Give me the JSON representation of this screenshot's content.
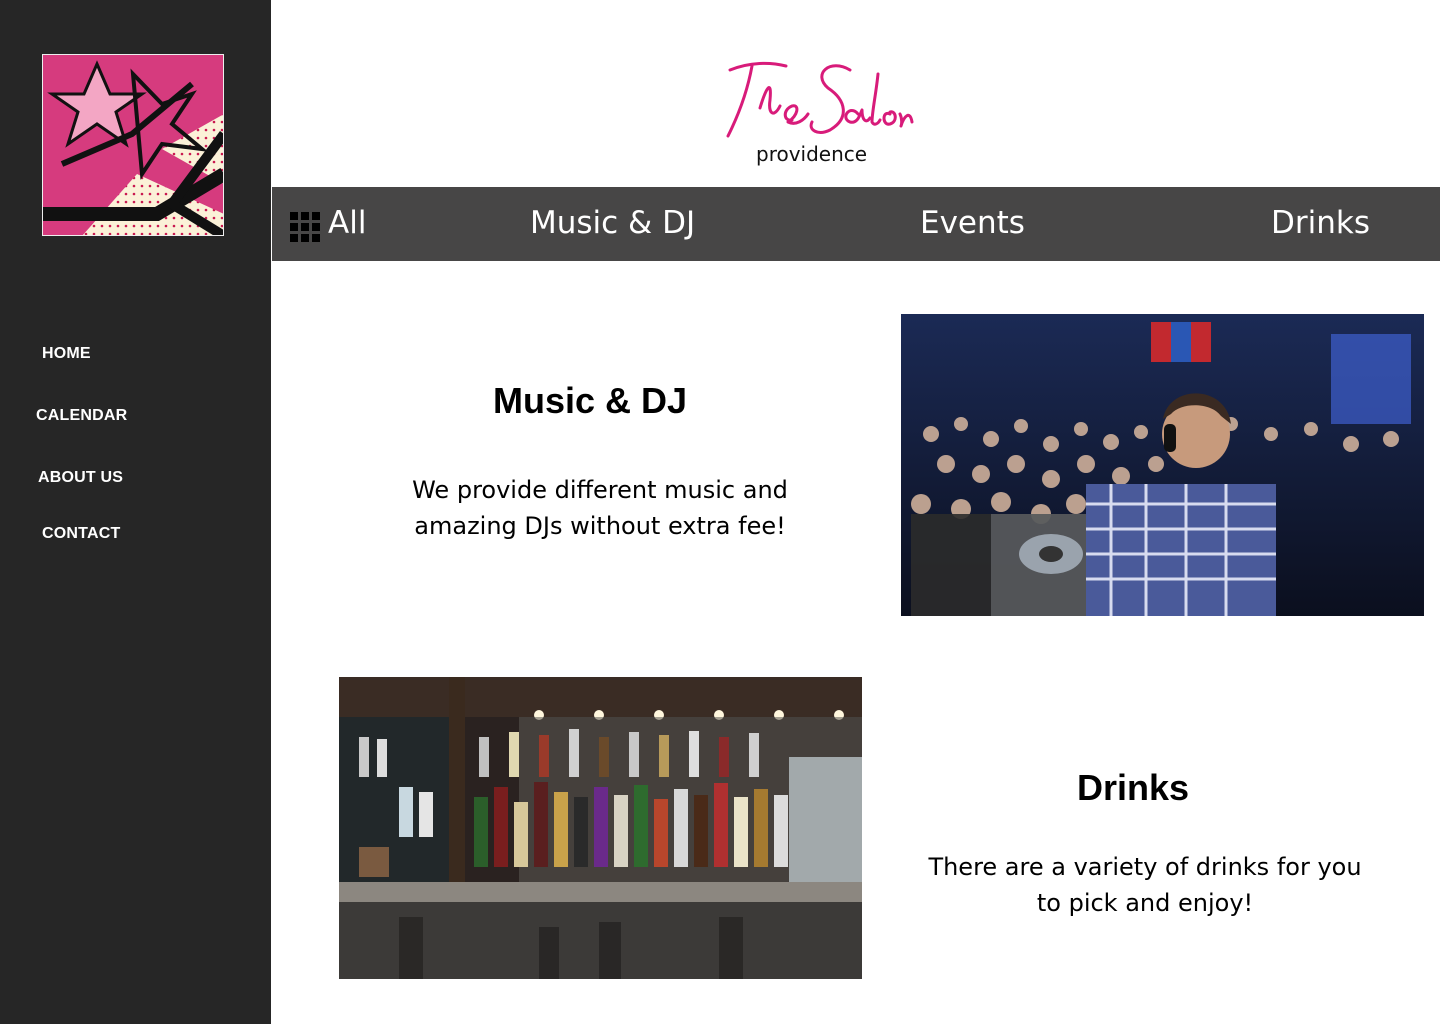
{
  "sidebar": {
    "nav": [
      {
        "label": "HOME"
      },
      {
        "label": "CALENDAR"
      },
      {
        "label": "ABOUT US"
      },
      {
        "label": "CONTACT"
      }
    ]
  },
  "brand": {
    "name": "The Salon",
    "subtitle": "providence",
    "color": "#d81b7a"
  },
  "filters": [
    {
      "label": "All",
      "icon": "grid-icon"
    },
    {
      "label": "Music & DJ"
    },
    {
      "label": "Events"
    },
    {
      "label": "Drinks"
    }
  ],
  "sections": [
    {
      "title": "Music & DJ",
      "text_line1": "We provide different music and",
      "text_line2": "amazing DJs without extra fee!"
    },
    {
      "title": "Drinks",
      "text_line1": "There are a variety of drinks for you",
      "text_line2": "to pick and enjoy!"
    }
  ],
  "colors": {
    "sidebar_bg": "#262626",
    "filter_bar_bg": "#474646",
    "accent_pink": "#d81b7a"
  }
}
